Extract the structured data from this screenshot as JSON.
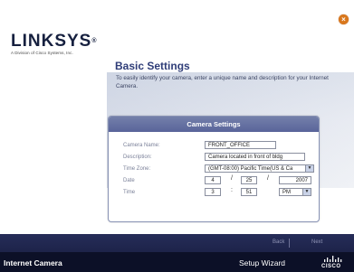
{
  "brand": {
    "logo_text": "LINKSYS",
    "registered": "®",
    "tagline": "A Division of Cisco Systems, Inc."
  },
  "close_symbol": "×",
  "page": {
    "title": "Basic Settings",
    "intro": "To easily identify your camera, enter a unique name and description for your Internet Camera."
  },
  "panel": {
    "title": "Camera Settings",
    "fields": {
      "camera_name": {
        "label": "Camera Name:",
        "value": "FRONT_OFFICE"
      },
      "description": {
        "label": "Description:",
        "value": "Camera located in front of bldg"
      },
      "time_zone": {
        "label": "Time Zone:",
        "value": "(GMT-08:00) Pacific Time(US & Ca"
      },
      "date": {
        "label": "Date",
        "month": "4",
        "day": "25",
        "year": "2007",
        "separator": "/"
      },
      "time": {
        "label": "Time",
        "hour": "3",
        "minute": "51",
        "ampm": "PM",
        "separator": ":"
      }
    }
  },
  "nav": {
    "back_label": "Back",
    "next_label": "Next"
  },
  "footer": {
    "product": "Internet Camera",
    "wizard": "Setup Wizard",
    "cisco": "CISCO"
  },
  "colors": {
    "brand_navy": "#16203f",
    "title_blue": "#2f3d78",
    "panel_header": "#5f6a9f",
    "close_orange": "#d9771c",
    "footer_dark": "#0c1027"
  }
}
